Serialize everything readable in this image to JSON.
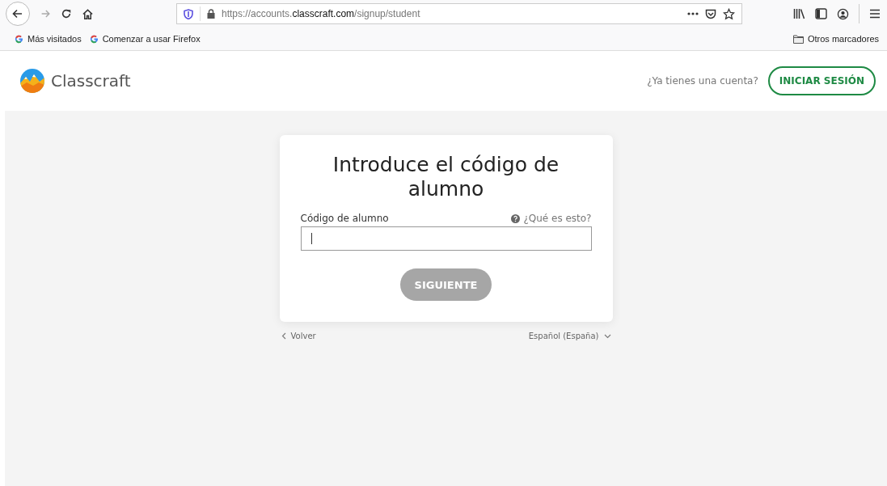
{
  "browser": {
    "url": {
      "prefix": "https://accounts.",
      "domain": "classcraft.com",
      "suffix": "/signup/student"
    },
    "forward_disabled": true,
    "bookmarks": [
      {
        "label": "Más visitados"
      },
      {
        "label": "Comenzar a usar Firefox"
      }
    ],
    "other_bookmarks": "Otros marcadores"
  },
  "header": {
    "brand": "Classcraft",
    "account_prompt": "¿Ya tienes una cuenta?",
    "login_button": "INICIAR SESIÓN"
  },
  "card": {
    "title": "Introduce el código de alumno",
    "field_label": "Código de alumno",
    "help_link": "¿Qué es esto?",
    "field_focused": true,
    "next_button": {
      "label": "SIGUIENTE",
      "disabled": true
    }
  },
  "footer": {
    "back_link": "Volver",
    "language": "Español (España)"
  }
}
